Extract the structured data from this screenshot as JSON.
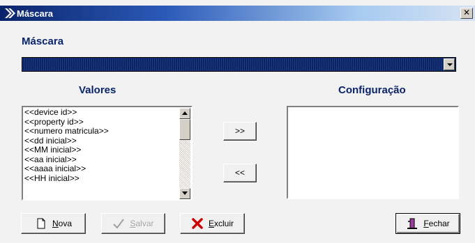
{
  "window": {
    "title": "Máscara",
    "close_glyph": "✕"
  },
  "mascara": {
    "label": "Máscara",
    "selected_value": ""
  },
  "valores": {
    "heading": "Valores",
    "items": [
      "<<device id>>",
      "<<property id>>",
      "<<numero matricula>>",
      "<<dd inicial>>",
      "<<MM inicial>>",
      "<<aa inicial>>",
      "<<aaaa inicial>>",
      "<<HH inicial>>"
    ]
  },
  "configuracao": {
    "heading": "Configuração",
    "items": []
  },
  "move_buttons": {
    "add_label": ">>",
    "remove_label": "<<"
  },
  "actions": {
    "nova_label": "Nova",
    "salvar_label": "Salvar",
    "excluir_label": "Excluir",
    "fechar_label": "Fechar"
  },
  "icons": {
    "title": "chevron-right-icon",
    "nova": "new-document-icon",
    "salvar": "checkmark-icon",
    "excluir": "red-x-icon",
    "fechar": "door-exit-icon"
  },
  "colors": {
    "heading": "#0a246a",
    "selection": "#0a246a",
    "excluir_icon": "#cc0000"
  }
}
